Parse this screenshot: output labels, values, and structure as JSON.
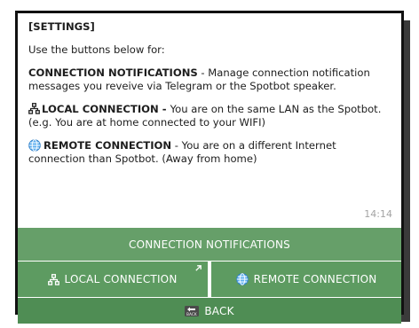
{
  "message": {
    "title": "[SETTINGS]",
    "intro": "Use the buttons below for:",
    "items": [
      {
        "icon": "none",
        "heading": "CONNECTION NOTIFICATIONS",
        "text": " - Manage connection notification messages you reveive via Telegram or the Spotbot speaker."
      },
      {
        "icon": "lan-icon",
        "heading": "LOCAL CONNECTION - ",
        "text": "You are on the same LAN as the Spotbot. (e.g. You are at home connected to your WIFI)"
      },
      {
        "icon": "globe-icon",
        "heading": "REMOTE CONNECTION",
        "text": " - You are on a different Internet connection than Spotbot. (Away from home)"
      }
    ],
    "time": "14:14"
  },
  "keyboard": {
    "connection_notifications": "CONNECTION NOTIFICATIONS",
    "local_connection": "LOCAL CONNECTION",
    "remote_connection": "REMOTE CONNECTION",
    "back_icon_text": "BACK",
    "back": "BACK"
  },
  "colors": {
    "button_green": "#5d9b61",
    "globe_blue": "#3f8fd8"
  }
}
